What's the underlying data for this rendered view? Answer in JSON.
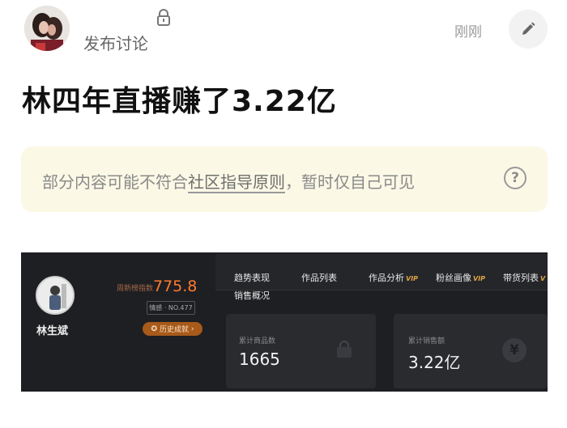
{
  "post": {
    "author_label": "发布讨论",
    "timestamp": "刚刚",
    "title": "林四年直播赚了3.22亿"
  },
  "notice": {
    "text_before": "部分内容可能不符合",
    "link_text": "社区指导原则",
    "text_after": "，暂时仅自己可见"
  },
  "embedded": {
    "streamer_name": "林生斌",
    "rank_label": "周新榜指数",
    "rank_value": "775.8",
    "rank_tag": "情感 · NO.477",
    "history_label": "历史成就",
    "tabs": [
      {
        "label": "趋势表现",
        "vip": ""
      },
      {
        "label": "作品列表",
        "vip": ""
      },
      {
        "label": "作品分析",
        "vip": "VIP"
      },
      {
        "label": "粉丝画像",
        "vip": "VIP"
      },
      {
        "label": "带货列表",
        "vip": "V"
      }
    ],
    "section_label": "销售概况",
    "cards": [
      {
        "label": "累计商品数",
        "value": "1665",
        "icon": "shopping-bag-icon"
      },
      {
        "label": "累计销售额",
        "value": "3.22亿",
        "icon": "yen-icon"
      }
    ]
  },
  "icons": {
    "lock": "lock-icon",
    "edit": "pencil-icon",
    "help": "question-circle-icon"
  },
  "colors": {
    "notice_bg": "#fbf8e6",
    "rank_value": "#ff7a2f",
    "vip": "#e0a544",
    "embedded_bg": "#1e1f22"
  }
}
